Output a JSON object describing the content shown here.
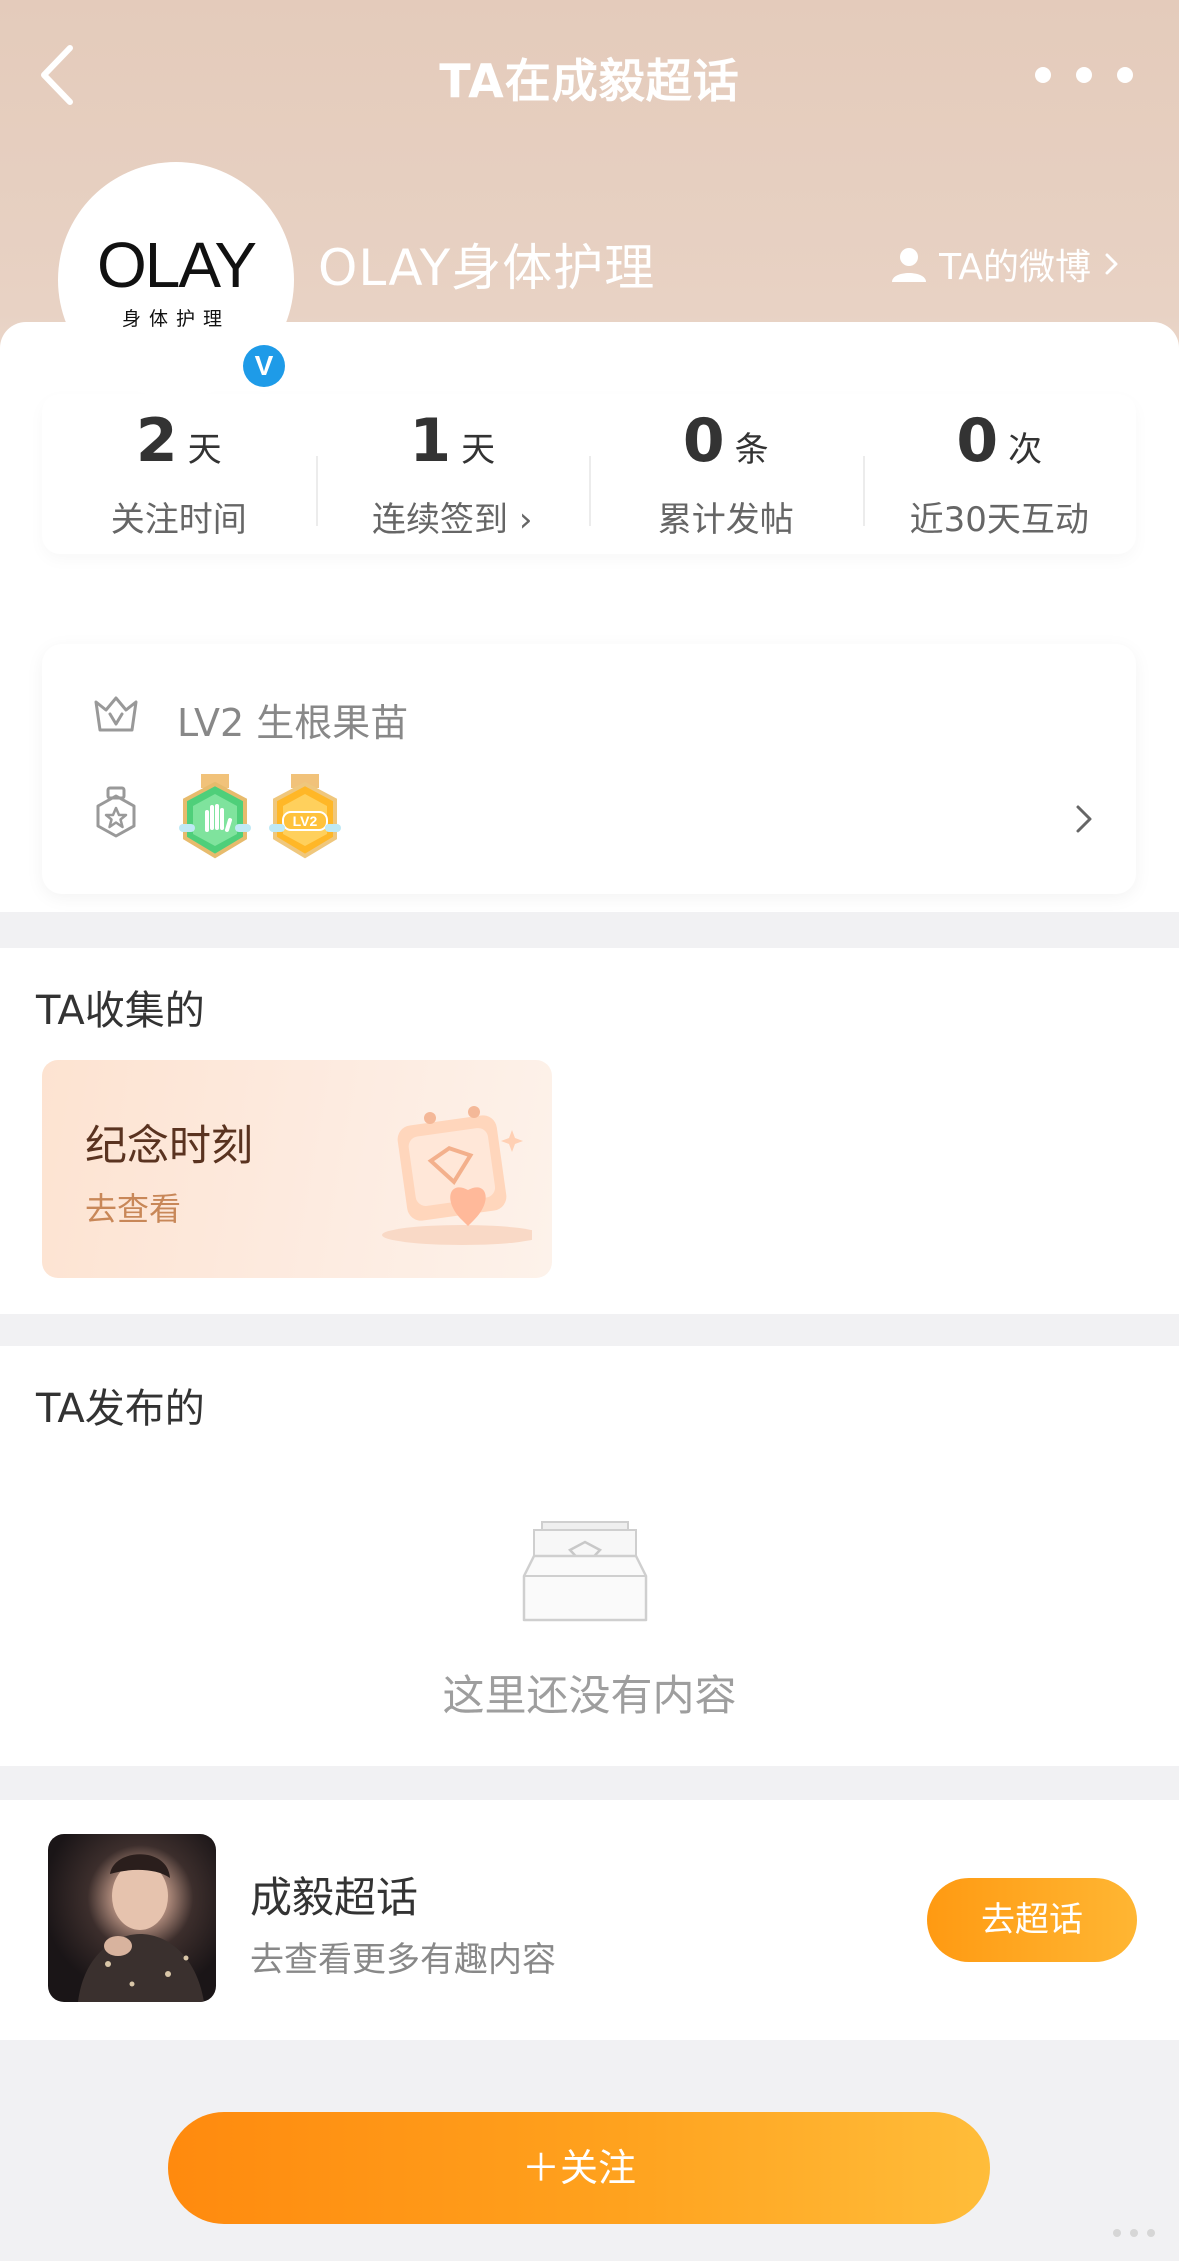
{
  "header": {
    "title": "TA在成毅超话",
    "back_icon": "chevron-left-icon",
    "more_icon": "more-dots-icon"
  },
  "profile": {
    "avatar_logo_main": "OLAY",
    "avatar_logo_sub": "身体护理",
    "verified_glyph": "V",
    "username": "OLAY身体护理",
    "weibo_link_label": "TA的微博"
  },
  "stats": [
    {
      "value": "2",
      "unit": "天",
      "label": "关注时间"
    },
    {
      "value": "1",
      "unit": "天",
      "label": "连续签到 ›"
    },
    {
      "value": "0",
      "unit": "条",
      "label": "累计发帖"
    },
    {
      "value": "0",
      "unit": "次",
      "label": "近30天互动"
    }
  ],
  "level": {
    "text": "LV2 生根果苗",
    "medal_badges": [
      "hand-medal",
      "lv2-medal"
    ],
    "medal_lv_text": "LV2"
  },
  "collected": {
    "title": "TA收集的",
    "card_title": "纪念时刻",
    "card_link": "去查看"
  },
  "posts": {
    "title": "TA发布的",
    "empty_text": "这里还没有内容"
  },
  "topic": {
    "name": "成毅超话",
    "subtitle": "去查看更多有趣内容",
    "button_label": "去超话"
  },
  "follow": {
    "button_label": "＋关注"
  },
  "colors": {
    "header_bg": "#e4cbbb",
    "accent_orange": "#ff9a12",
    "verify_blue": "#1e9be8"
  }
}
